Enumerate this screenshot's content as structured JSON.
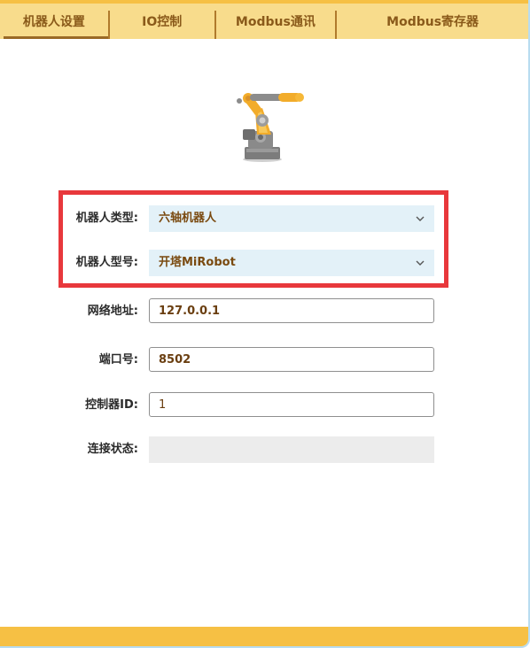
{
  "tabs": [
    {
      "label": "机器人设置",
      "active": true
    },
    {
      "label": "IO控制",
      "active": false
    },
    {
      "label": "Modbus通讯",
      "active": false
    },
    {
      "label": "Modbus寄存器",
      "active": false
    }
  ],
  "icons": {
    "robot_image": "industrial-robot-arm",
    "select_chevron": "chevron-down-icon"
  },
  "colors": {
    "tab_bar": "#f8dc8c",
    "accent": "#f6c044",
    "highlight_border": "#e8383c",
    "select_bg": "#e3f1f8"
  },
  "form": {
    "robot_type": {
      "label": "机器人类型:",
      "value": "六轴机器人"
    },
    "robot_model": {
      "label": "机器人型号:",
      "value": "开塔MiRobot"
    },
    "network_address": {
      "label": "网络地址:",
      "value": "127.0.0.1"
    },
    "port": {
      "label": "端口号:",
      "value": "8502"
    },
    "controller_id": {
      "label": "控制器ID:",
      "value": "1"
    },
    "connection_status": {
      "label": "连接状态:",
      "value": ""
    }
  }
}
